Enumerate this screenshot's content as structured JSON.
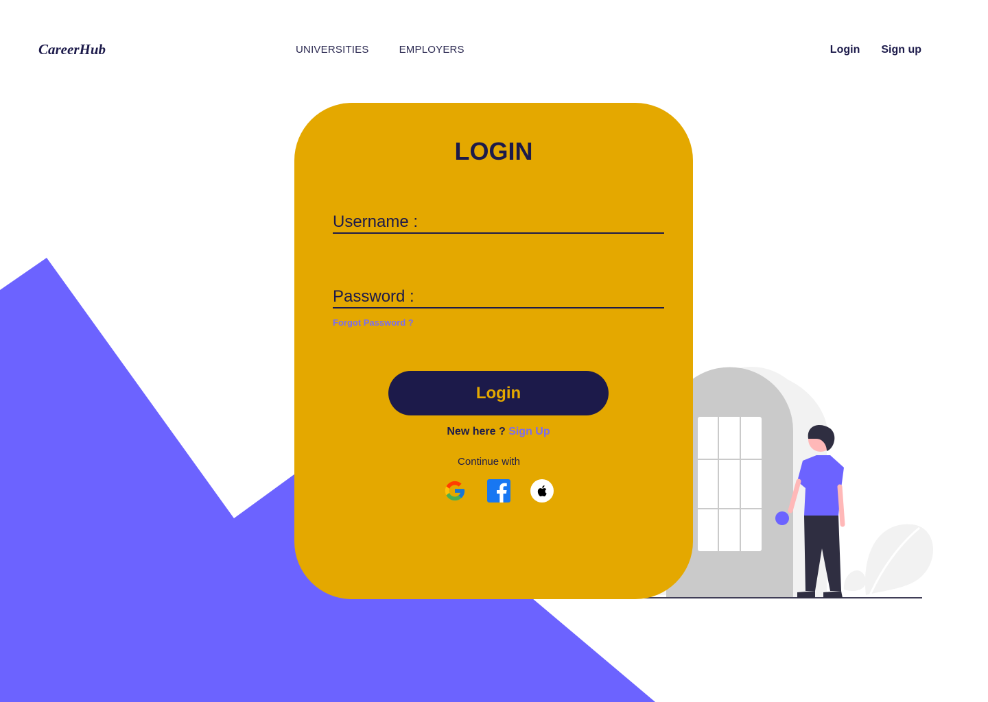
{
  "brand": {
    "name": "CareerHub"
  },
  "nav": {
    "items": [
      "UNIVERSITIES",
      "EMPLOYERS"
    ]
  },
  "auth": {
    "login": "Login",
    "signup": "Sign up"
  },
  "form": {
    "title": "LOGIN",
    "username_label": "Username :",
    "username_value": "",
    "password_label": "Password :",
    "password_value": "",
    "forgot": "Forgot Password ?",
    "submit": "Login",
    "new_here": "New here ?",
    "signup_link": "Sign Up",
    "continue_with": "Continue with",
    "social": [
      "google-icon",
      "facebook-icon",
      "apple-icon"
    ]
  },
  "colors": {
    "card": "#e4a800",
    "primary": "#1c1a4a",
    "accent": "#6c63ff",
    "link": "#7a6cf0"
  }
}
